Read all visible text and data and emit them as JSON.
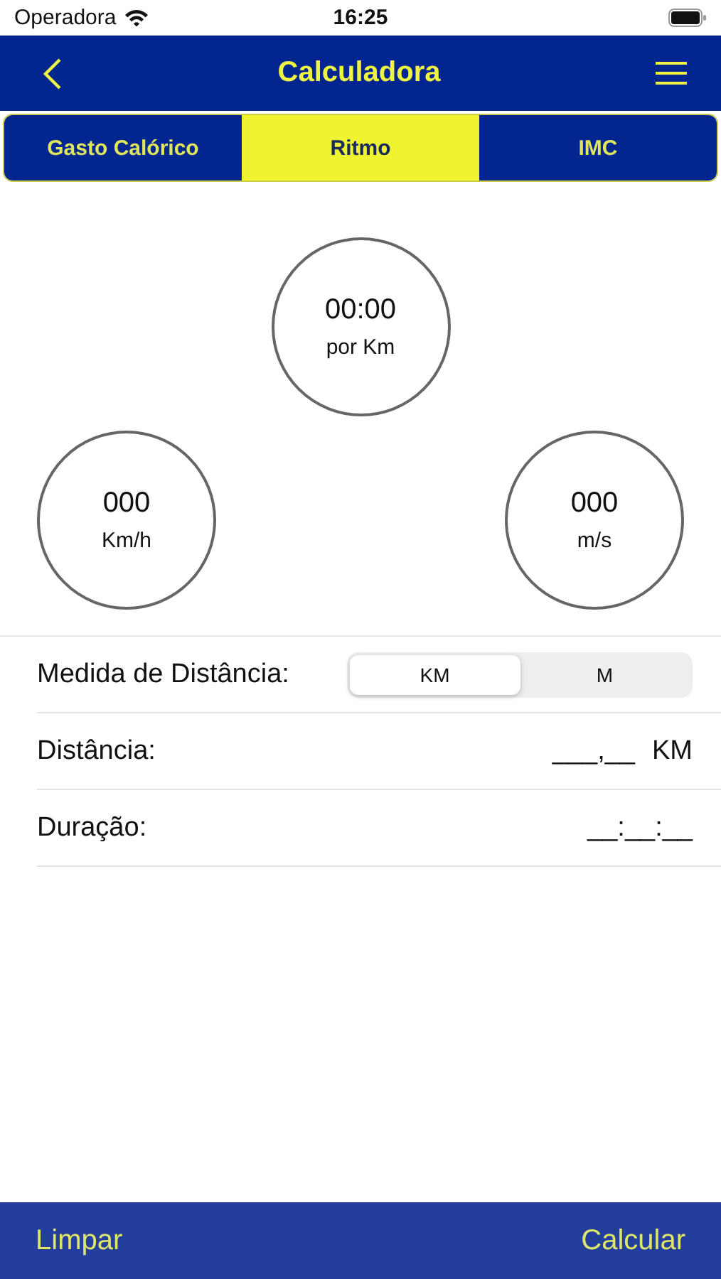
{
  "status_bar": {
    "carrier": "Operadora",
    "time": "16:25"
  },
  "nav": {
    "title": "Calculadora"
  },
  "tabs": [
    {
      "label": "Gasto Calórico",
      "selected": false
    },
    {
      "label": "Ritmo",
      "selected": true
    },
    {
      "label": "IMC",
      "selected": false
    }
  ],
  "readouts": [
    {
      "value": "00:00",
      "unit": "por Km"
    },
    {
      "value": "000",
      "unit": "Km/h"
    },
    {
      "value": "000",
      "unit": "m/s"
    }
  ],
  "distance_unit": {
    "label": "Medida de Distância:",
    "options": [
      {
        "label": "KM",
        "selected": true
      },
      {
        "label": "M",
        "selected": false
      }
    ]
  },
  "fields": [
    {
      "label": "Distância:",
      "value": "___,__",
      "suffix": "KM"
    },
    {
      "label": "Duração:",
      "value": "__:__:__"
    }
  ],
  "toolbar": {
    "left": "Limpar",
    "right": "Calcular"
  }
}
